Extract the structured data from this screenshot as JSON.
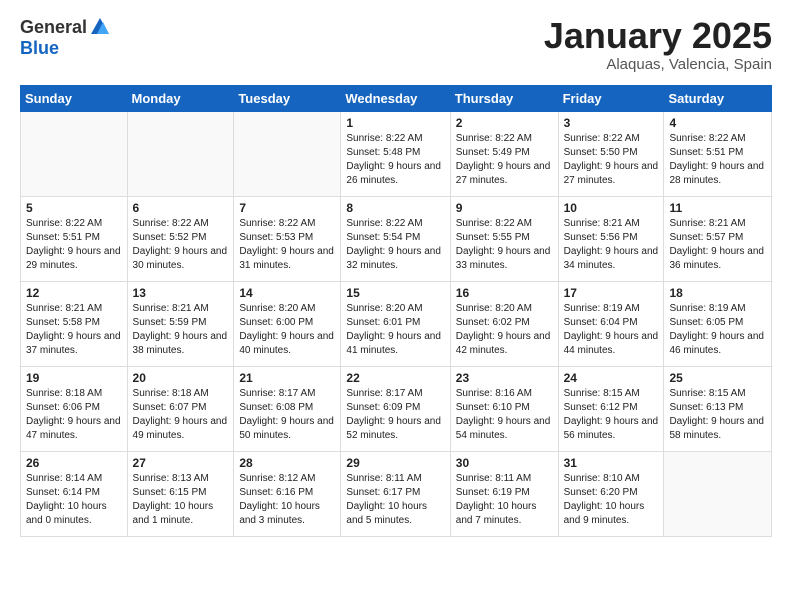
{
  "header": {
    "logo_general": "General",
    "logo_blue": "Blue",
    "month_title": "January 2025",
    "location": "Alaquas, Valencia, Spain"
  },
  "weekdays": [
    "Sunday",
    "Monday",
    "Tuesday",
    "Wednesday",
    "Thursday",
    "Friday",
    "Saturday"
  ],
  "weeks": [
    [
      {
        "day": "",
        "info": ""
      },
      {
        "day": "",
        "info": ""
      },
      {
        "day": "",
        "info": ""
      },
      {
        "day": "1",
        "info": "Sunrise: 8:22 AM\nSunset: 5:48 PM\nDaylight: 9 hours and 26 minutes."
      },
      {
        "day": "2",
        "info": "Sunrise: 8:22 AM\nSunset: 5:49 PM\nDaylight: 9 hours and 27 minutes."
      },
      {
        "day": "3",
        "info": "Sunrise: 8:22 AM\nSunset: 5:50 PM\nDaylight: 9 hours and 27 minutes."
      },
      {
        "day": "4",
        "info": "Sunrise: 8:22 AM\nSunset: 5:51 PM\nDaylight: 9 hours and 28 minutes."
      }
    ],
    [
      {
        "day": "5",
        "info": "Sunrise: 8:22 AM\nSunset: 5:51 PM\nDaylight: 9 hours and 29 minutes."
      },
      {
        "day": "6",
        "info": "Sunrise: 8:22 AM\nSunset: 5:52 PM\nDaylight: 9 hours and 30 minutes."
      },
      {
        "day": "7",
        "info": "Sunrise: 8:22 AM\nSunset: 5:53 PM\nDaylight: 9 hours and 31 minutes."
      },
      {
        "day": "8",
        "info": "Sunrise: 8:22 AM\nSunset: 5:54 PM\nDaylight: 9 hours and 32 minutes."
      },
      {
        "day": "9",
        "info": "Sunrise: 8:22 AM\nSunset: 5:55 PM\nDaylight: 9 hours and 33 minutes."
      },
      {
        "day": "10",
        "info": "Sunrise: 8:21 AM\nSunset: 5:56 PM\nDaylight: 9 hours and 34 minutes."
      },
      {
        "day": "11",
        "info": "Sunrise: 8:21 AM\nSunset: 5:57 PM\nDaylight: 9 hours and 36 minutes."
      }
    ],
    [
      {
        "day": "12",
        "info": "Sunrise: 8:21 AM\nSunset: 5:58 PM\nDaylight: 9 hours and 37 minutes."
      },
      {
        "day": "13",
        "info": "Sunrise: 8:21 AM\nSunset: 5:59 PM\nDaylight: 9 hours and 38 minutes."
      },
      {
        "day": "14",
        "info": "Sunrise: 8:20 AM\nSunset: 6:00 PM\nDaylight: 9 hours and 40 minutes."
      },
      {
        "day": "15",
        "info": "Sunrise: 8:20 AM\nSunset: 6:01 PM\nDaylight: 9 hours and 41 minutes."
      },
      {
        "day": "16",
        "info": "Sunrise: 8:20 AM\nSunset: 6:02 PM\nDaylight: 9 hours and 42 minutes."
      },
      {
        "day": "17",
        "info": "Sunrise: 8:19 AM\nSunset: 6:04 PM\nDaylight: 9 hours and 44 minutes."
      },
      {
        "day": "18",
        "info": "Sunrise: 8:19 AM\nSunset: 6:05 PM\nDaylight: 9 hours and 46 minutes."
      }
    ],
    [
      {
        "day": "19",
        "info": "Sunrise: 8:18 AM\nSunset: 6:06 PM\nDaylight: 9 hours and 47 minutes."
      },
      {
        "day": "20",
        "info": "Sunrise: 8:18 AM\nSunset: 6:07 PM\nDaylight: 9 hours and 49 minutes."
      },
      {
        "day": "21",
        "info": "Sunrise: 8:17 AM\nSunset: 6:08 PM\nDaylight: 9 hours and 50 minutes."
      },
      {
        "day": "22",
        "info": "Sunrise: 8:17 AM\nSunset: 6:09 PM\nDaylight: 9 hours and 52 minutes."
      },
      {
        "day": "23",
        "info": "Sunrise: 8:16 AM\nSunset: 6:10 PM\nDaylight: 9 hours and 54 minutes."
      },
      {
        "day": "24",
        "info": "Sunrise: 8:15 AM\nSunset: 6:12 PM\nDaylight: 9 hours and 56 minutes."
      },
      {
        "day": "25",
        "info": "Sunrise: 8:15 AM\nSunset: 6:13 PM\nDaylight: 9 hours and 58 minutes."
      }
    ],
    [
      {
        "day": "26",
        "info": "Sunrise: 8:14 AM\nSunset: 6:14 PM\nDaylight: 10 hours and 0 minutes."
      },
      {
        "day": "27",
        "info": "Sunrise: 8:13 AM\nSunset: 6:15 PM\nDaylight: 10 hours and 1 minute."
      },
      {
        "day": "28",
        "info": "Sunrise: 8:12 AM\nSunset: 6:16 PM\nDaylight: 10 hours and 3 minutes."
      },
      {
        "day": "29",
        "info": "Sunrise: 8:11 AM\nSunset: 6:17 PM\nDaylight: 10 hours and 5 minutes."
      },
      {
        "day": "30",
        "info": "Sunrise: 8:11 AM\nSunset: 6:19 PM\nDaylight: 10 hours and 7 minutes."
      },
      {
        "day": "31",
        "info": "Sunrise: 8:10 AM\nSunset: 6:20 PM\nDaylight: 10 hours and 9 minutes."
      },
      {
        "day": "",
        "info": ""
      }
    ]
  ]
}
